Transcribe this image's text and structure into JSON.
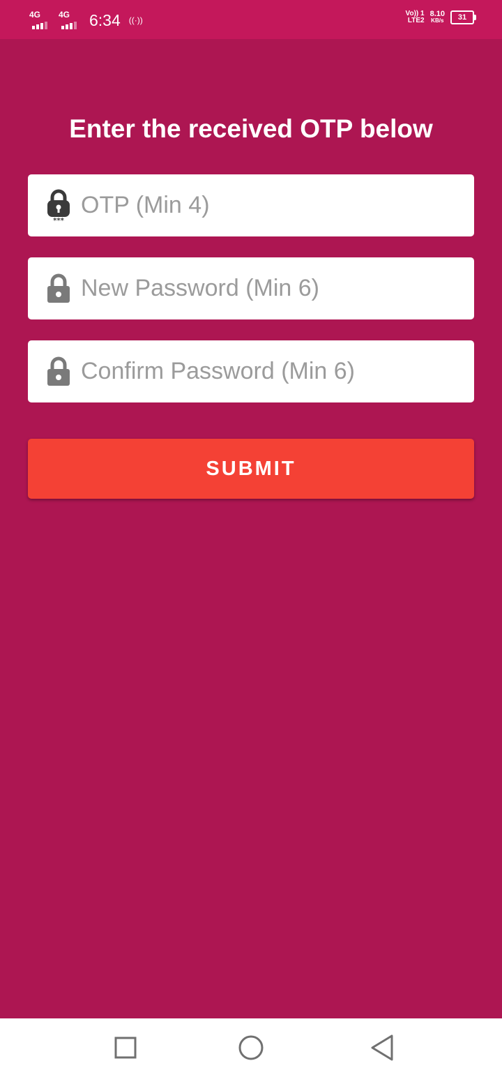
{
  "status_bar": {
    "sim1_network": "4G",
    "sim2_network": "4G",
    "time": "6:34",
    "volte_line1": "Vo)) 1",
    "volte_line2": "LTE2",
    "speed_value": "8.10",
    "speed_unit": "KB/s",
    "battery_level": "31"
  },
  "screen": {
    "title": "Enter the received OTP below"
  },
  "form": {
    "otp": {
      "placeholder": "OTP (Min 4)",
      "value": ""
    },
    "new_password": {
      "placeholder": "New Password (Min 6)",
      "value": ""
    },
    "confirm_password": {
      "placeholder": "Confirm Password (Min 6)",
      "value": ""
    },
    "submit_label": "SUBMIT"
  },
  "icons": {
    "otp_field": "lock-asterisks-icon",
    "new_password_field": "lock-icon",
    "confirm_password_field": "lock-icon",
    "nav_recents": "square-icon",
    "nav_home": "circle-icon",
    "nav_back": "triangle-back-icon"
  },
  "colors": {
    "status_bar": "#C4185B",
    "background": "#AD1652",
    "submit_button": "#F44135",
    "input_background": "#FFFFFF",
    "placeholder_text": "#9B9B9B",
    "icon_gray": "#757575"
  }
}
